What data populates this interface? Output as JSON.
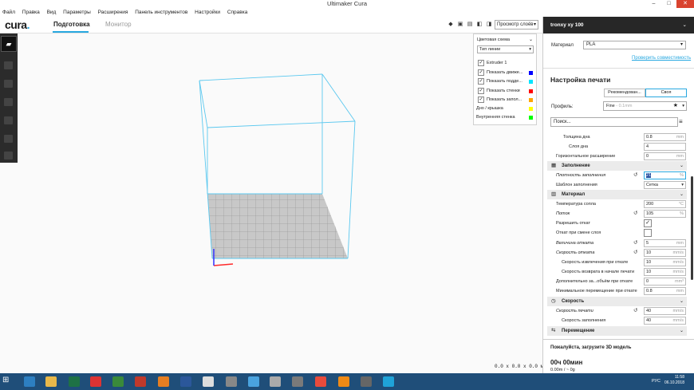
{
  "window": {
    "title": "Ultimaker Cura"
  },
  "menu": [
    "Файл",
    "Правка",
    "Вид",
    "Параметры",
    "Расширения",
    "Панель инструментов",
    "Настройки",
    "Справка"
  ],
  "topbar": {
    "logo": "cura",
    "tabs": [
      "Подготовка",
      "Монитор"
    ],
    "view_mode": "Просмотр слоёв"
  },
  "layer_view": {
    "color_scheme_label": "Цветовая схема",
    "color_scheme_value": "Тип линии",
    "extruder": "Extruder 1",
    "toggles": [
      {
        "label": "Показать движе...",
        "color": "#0000ff"
      },
      {
        "label": "Показать подде...",
        "color": "#00e5ff"
      },
      {
        "label": "Показать стенки",
        "color": "#ff0000"
      },
      {
        "label": "Показать запол...",
        "color": "#ffa500"
      }
    ],
    "legend": [
      {
        "label": "Дно / крышка",
        "color": "#ffff00"
      },
      {
        "label": "Внутренняя стенка",
        "color": "#00ff00"
      }
    ]
  },
  "viewport": {
    "coords": "0.0 x 0.0 x 0.0 мм"
  },
  "sidebar": {
    "printer": "tronxy xy 100",
    "material_label": "Материал",
    "material_value": "PLA",
    "compat_link": "Проверить совместимость",
    "print_setup_title": "Настройка печати",
    "mode_recommended": "Рекомендован...",
    "mode_custom": "Своя",
    "profile_label": "Профиль:",
    "profile_value": "Fine",
    "profile_hint": "- 0.1mm",
    "search_placeholder": "Поиск...",
    "settings": {
      "bottom_thickness": {
        "label": "Толщина дна",
        "value": "0.8",
        "unit": "mm"
      },
      "bottom_layers": {
        "label": "Слоя дна",
        "value": "4"
      },
      "horiz_expansion": {
        "label": "Горизонтальное расширение",
        "value": "0",
        "unit": "mm"
      },
      "cat_infill": "Заполнение",
      "infill_density": {
        "label": "Плотность заполнения",
        "value": "21",
        "unit": "%"
      },
      "infill_pattern": {
        "label": "Шаблон заполнения",
        "value": "Сетка"
      },
      "cat_material": "Материал",
      "nozzle_temp": {
        "label": "Температура сопла",
        "value": "200",
        "unit": "°C"
      },
      "flow": {
        "label": "Поток",
        "value": "105",
        "unit": "%"
      },
      "retraction_enable": {
        "label": "Разрешить откат"
      },
      "retract_layer_change": {
        "label": "Откат при смене слоя"
      },
      "retraction_distance": {
        "label": "Величина отката",
        "value": "5",
        "unit": "mm"
      },
      "retraction_speed": {
        "label": "Скорость отката",
        "value": "10",
        "unit": "mm/s"
      },
      "retraction_retract_speed": {
        "label": "Скорость извлечения при откате",
        "value": "10",
        "unit": "mm/s"
      },
      "retraction_prime_speed": {
        "label": "Скорость возврата в начале печати",
        "value": "10",
        "unit": "mm/s"
      },
      "retraction_extra_prime": {
        "label": "Дополнительно за...объём при откате",
        "value": "0",
        "unit": "mm³"
      },
      "retraction_min_travel": {
        "label": "Минимальное перемещение при откате",
        "value": "0.8",
        "unit": "mm"
      },
      "cat_speed": "Скорость",
      "print_speed": {
        "label": "Скорость печати",
        "value": "40",
        "unit": "mm/s"
      },
      "infill_speed": {
        "label": "Скорость заполнения",
        "value": "40",
        "unit": "mm/s"
      },
      "cat_travel": "Перемещение"
    },
    "bottom_message": "Пожалуйста, загрузите 3D модель",
    "bottom_time": "00ч 00мин",
    "bottom_length": "0.00m / ~ 0g"
  },
  "taskbar": {
    "lang": "РУС",
    "time": "11:58",
    "date": "06.10.2018"
  }
}
